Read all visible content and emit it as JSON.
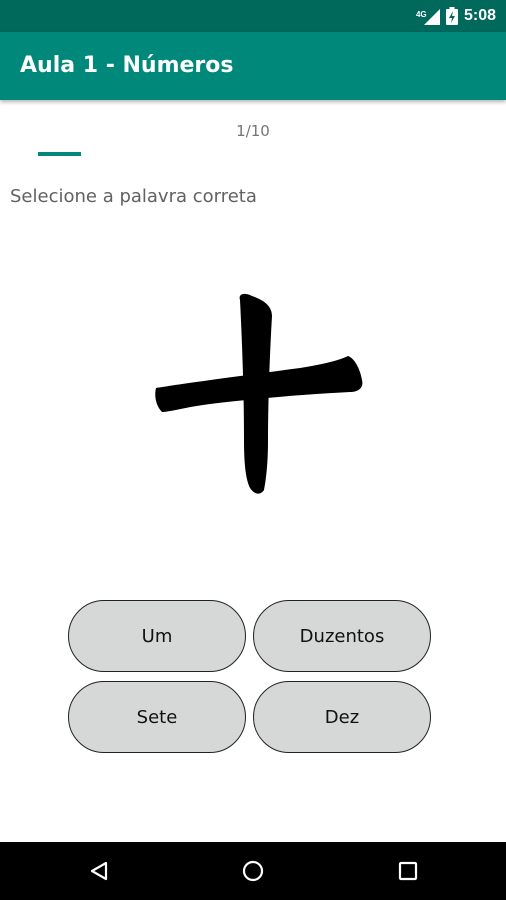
{
  "status_bar": {
    "network": "4G",
    "time": "5:08",
    "icons": [
      "signal-icon",
      "battery-icon"
    ]
  },
  "app_bar": {
    "title": "Aula 1 - Números"
  },
  "progress": {
    "text": "1/10",
    "fraction": 0.1
  },
  "instruction": "Selecione a palavra correta",
  "question": {
    "character": "十"
  },
  "answers": [
    "Um",
    "Duzentos",
    "Sete",
    "Dez"
  ],
  "nav_bar": {
    "icons": [
      "back-icon",
      "home-icon",
      "recents-icon"
    ]
  },
  "colors": {
    "status_bar": "#00695c",
    "primary": "#00897b",
    "button_bg": "#d6d7d7",
    "nav_bar": "#000000"
  }
}
